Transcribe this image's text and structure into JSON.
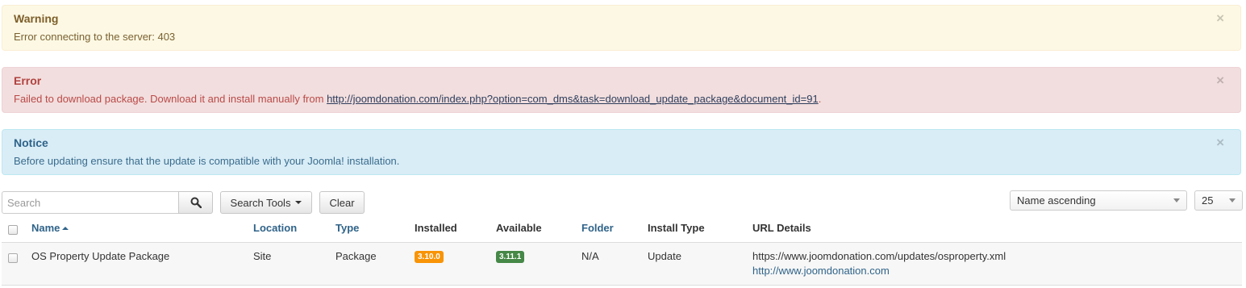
{
  "alerts": {
    "warning": {
      "title": "Warning",
      "message": "Error connecting to the server: 403",
      "close": "×"
    },
    "error": {
      "title": "Error",
      "message_prefix": "Failed to download package. Download it and install manually from ",
      "link": "http://joomdonation.com/index.php?option=com_dms&task=download_update_package&document_id=91",
      "message_suffix": ".",
      "close": "×"
    },
    "notice": {
      "title": "Notice",
      "message": "Before updating ensure that the update is compatible with your Joomla! installation.",
      "close": "×"
    }
  },
  "toolbar": {
    "search_placeholder": "Search",
    "search_tools_label": "Search Tools",
    "clear_label": "Clear",
    "sort_select": "Name ascending",
    "limit_select": "25"
  },
  "table": {
    "headers": {
      "name": "Name",
      "location": "Location",
      "type": "Type",
      "installed": "Installed",
      "available": "Available",
      "folder": "Folder",
      "install_type": "Install Type",
      "url_details": "URL Details"
    },
    "rows": [
      {
        "name": "OS Property Update Package",
        "location": "Site",
        "type": "Package",
        "installed": "3.10.0",
        "available": "3.11.1",
        "folder": "N/A",
        "install_type": "Update",
        "url": "https://www.joomdonation.com/updates/osproperty.xml",
        "info_url": "http://www.joomdonation.com"
      }
    ]
  },
  "colors": {
    "warning_bg": "#fcf8e3",
    "error_bg": "#f2dede",
    "notice_bg": "#d9edf7",
    "installed_badge": "#f89406",
    "available_badge": "#468847",
    "link": "#2f6389"
  },
  "icons": {
    "search": "search-icon",
    "close": "close-icon",
    "sort": "sort-ascending-icon",
    "dropdown": "chevron-down-icon"
  }
}
